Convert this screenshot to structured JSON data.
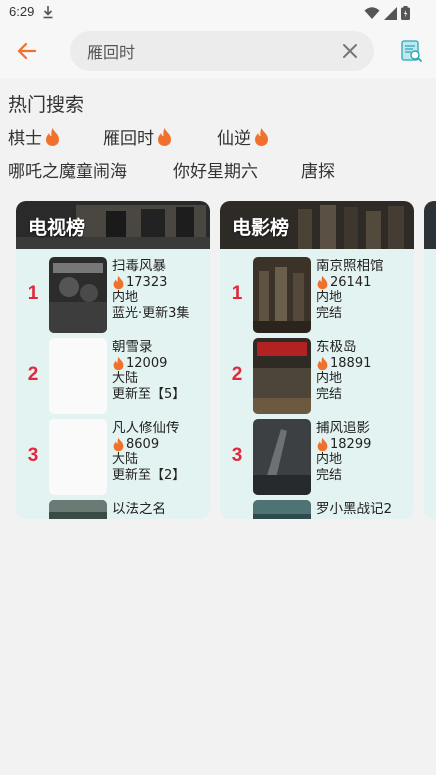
{
  "status": {
    "time": "6:29"
  },
  "search": {
    "value": "雁回时",
    "placeholder": "雁回时"
  },
  "hot": {
    "title": "热门搜索",
    "keywords": [
      "棋士",
      "雁回时",
      "仙逆",
      "哪吒之魔童闹海",
      "你好星期六",
      "唐探"
    ]
  },
  "rankings": [
    {
      "title": "电视榜",
      "items": [
        {
          "rank": "1",
          "name": "扫毒风暴",
          "heat": "17323",
          "region": "内地",
          "status": "蓝光·更新3集"
        },
        {
          "rank": "2",
          "name": "朝雪录",
          "heat": "12009",
          "region": "大陆",
          "status": "更新至【5】"
        },
        {
          "rank": "3",
          "name": "凡人修仙传",
          "heat": "8609",
          "region": "大陆",
          "status": "更新至【2】"
        },
        {
          "name": "以法之名"
        }
      ]
    },
    {
      "title": "电影榜",
      "items": [
        {
          "rank": "1",
          "name": "南京照相馆",
          "heat": "26141",
          "region": "内地",
          "status": "完结"
        },
        {
          "rank": "2",
          "name": "东极岛",
          "heat": "18891",
          "region": "内地",
          "status": "完结"
        },
        {
          "rank": "3",
          "name": "捕风追影",
          "heat": "18299",
          "region": "内地",
          "status": "完结"
        },
        {
          "name": "罗小黑战记2"
        }
      ]
    }
  ],
  "colors": {
    "accent": "#f0712c",
    "rank": "#e0273d",
    "card_bg": "#e3f3f1",
    "flame": "#f0712c"
  }
}
